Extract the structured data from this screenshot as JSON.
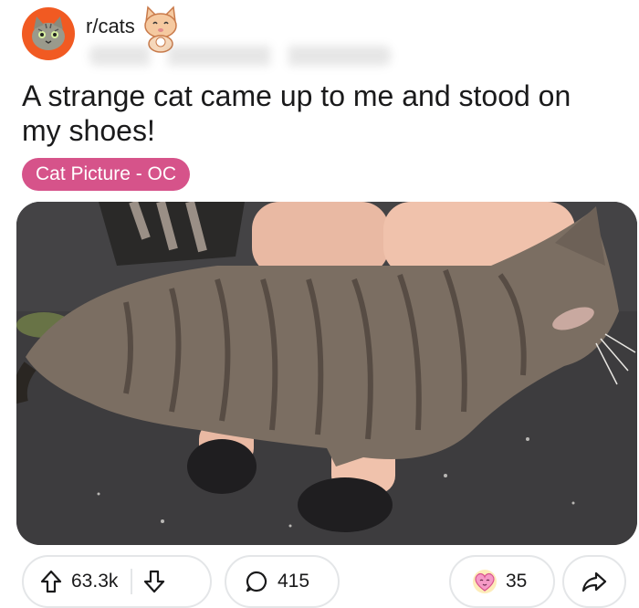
{
  "subreddit": {
    "name": "r/cats",
    "avatar_icon": "cat-avatar-icon",
    "flair_icon": "cat-emoji-icon"
  },
  "post": {
    "title": "A strange cat came up to me and stood on my shoes!",
    "flair": "Cat Picture - OC",
    "flair_color": "#d6538a",
    "image_icon": "cat-photo-image"
  },
  "actions": {
    "upvotes": "63.3k",
    "comments": "415",
    "awards": "35",
    "upvote_icon": "upvote-icon",
    "downvote_icon": "downvote-icon",
    "comment_icon": "comment-icon",
    "award_icon": "heart-award-icon",
    "share_icon": "share-icon"
  },
  "colors": {
    "avatar_bg": "#f15a22",
    "pill_border": "#e4e6e8"
  }
}
